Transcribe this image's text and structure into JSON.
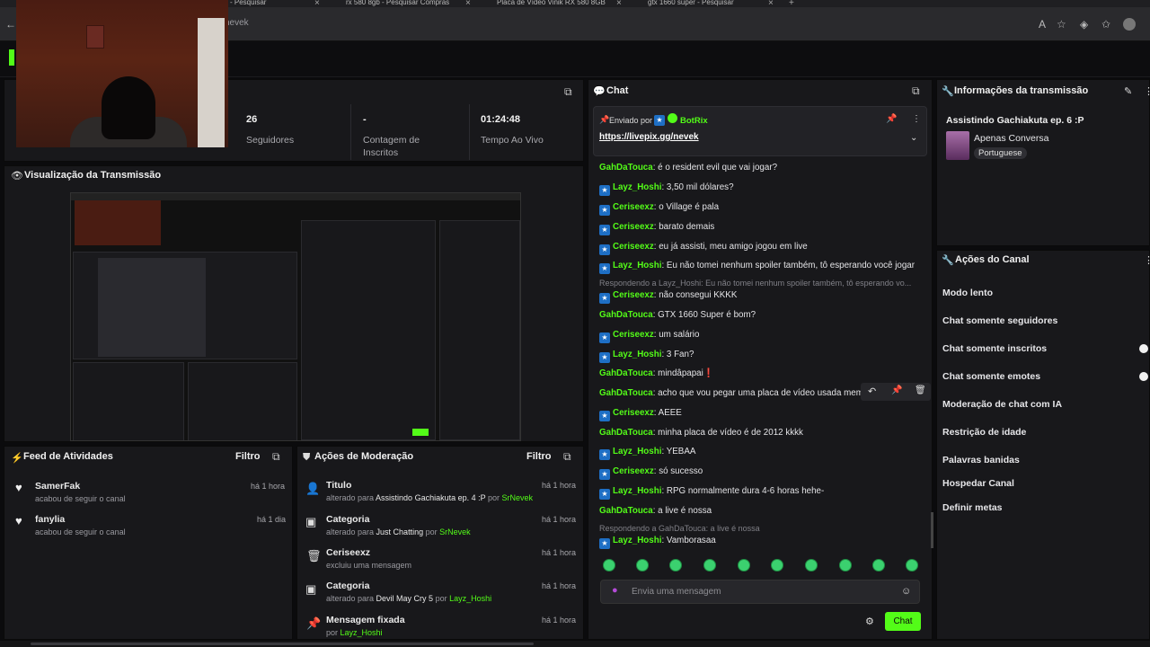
{
  "browser": {
    "tabs": [
      "- Pesquisar",
      "rx 580 8gb - Pesquisar Compras",
      "Placa de Vídeo Vinik RX 580 8GB",
      "gtx 1660 super - Pesquisar"
    ],
    "url": "nevek"
  },
  "stats": [
    {
      "value": "26",
      "label": "Seguidores"
    },
    {
      "value": "-",
      "label": "Contagem de Inscritos"
    },
    {
      "value": "01:24:48",
      "label": "Tempo Ao Vivo"
    }
  ],
  "preview": {
    "title": "Visualização da Transmissão"
  },
  "feed": {
    "title": "Feed de Atividades",
    "filter": "Filtro",
    "items": [
      {
        "name": "SamerFak",
        "sub": "acabou de seguir o canal",
        "time": "há 1 hora"
      },
      {
        "name": "fanylia",
        "sub": "acabou de seguir o canal",
        "time": "há 1 dia"
      }
    ]
  },
  "moderation": {
    "title": "Ações de Moderação",
    "filter": "Filtro",
    "items": [
      {
        "title": "Titulo",
        "pre": "alterado para ",
        "value": "Assistindo Gachiakuta ep. 4 :P",
        "by": " por ",
        "user": "SrNevek",
        "time": "há 1 hora"
      },
      {
        "title": "Categoria",
        "pre": "alterado para ",
        "value": "Just Chatting",
        "by": " por ",
        "user": "SrNevek",
        "time": "há 1 hora"
      },
      {
        "title": "Ceriseexz",
        "pre": "excluiu uma mensagem",
        "value": "",
        "by": "",
        "user": "",
        "time": "há 1 hora"
      },
      {
        "title": "Categoria",
        "pre": "alterado para ",
        "value": "Devil May Cry 5",
        "by": " por ",
        "user": "Layz_Hoshi",
        "time": "há 1 hora"
      },
      {
        "title": "Mensagem fixada",
        "pre": "por ",
        "value": "",
        "by": "",
        "user": "Layz_Hoshi",
        "time": "há 1 hora"
      }
    ]
  },
  "chat": {
    "title": "Chat",
    "pinned": {
      "label": "Enviado por",
      "user": "BotRix",
      "link": "https://livepix.gg/nevek"
    },
    "messages": [
      {
        "user": "GahDaTouca",
        "text": "é o resident evil que vai jogar?",
        "badge": false
      },
      {
        "user": "Layz_Hoshi",
        "text": "3,50 mil dólares?",
        "badge": true
      },
      {
        "user": "Ceriseexz",
        "text": "o Village é pala",
        "badge": true
      },
      {
        "user": "Ceriseexz",
        "text": "barato demais",
        "badge": true
      },
      {
        "user": "Ceriseexz",
        "text": "eu já assisti, meu amigo jogou em live",
        "badge": true
      },
      {
        "user": "Layz_Hoshi",
        "text": "Eu não tomei nenhum spoiler também, tô esperando você jogar",
        "badge": true
      },
      {
        "user": "Ceriseexz",
        "text": "não consegui KKKK",
        "badge": true
      },
      {
        "user": "GahDaTouca",
        "text": "GTX 1660 Super é bom?",
        "badge": false
      },
      {
        "user": "Ceriseexz",
        "text": "um salário",
        "badge": true
      },
      {
        "user": "Layz_Hoshi",
        "text": "3 Fan?",
        "badge": true
      },
      {
        "user": "GahDaTouca",
        "text": "mindâpapai❗",
        "badge": false
      },
      {
        "user": "GahDaTouca",
        "text": "acho que vou pegar uma placa de vídeo usada mem",
        "badge": false
      },
      {
        "user": "Ceriseexz",
        "text": "AEEE",
        "badge": true
      },
      {
        "user": "GahDaTouca",
        "text": "minha placa de vídeo é de 2012 kkkk",
        "badge": false
      },
      {
        "user": "Layz_Hoshi",
        "text": "YEBAA",
        "badge": true
      },
      {
        "user": "Ceriseexz",
        "text": "só sucesso",
        "badge": true
      },
      {
        "user": "Layz_Hoshi",
        "text": "RPG normalmente dura 4-6 horas hehe-",
        "badge": true
      },
      {
        "user": "GahDaTouca",
        "text": "a live é nossa",
        "badge": false
      },
      {
        "user": "Layz_Hoshi",
        "text": "Vamborasaa",
        "badge": true
      }
    ],
    "replies": [
      "Respondendo a Layz_Hoshi: Eu não tomei nenhum spoiler também, tô esperando vo...",
      "Respondendo a GahDaTouca: a live é nossa"
    ],
    "input_placeholder": "Envia uma mensagem",
    "send_label": "Chat"
  },
  "stream_info": {
    "title": "Informações da transmissão",
    "stream_title": "Assistindo Gachiakuta ep. 6 :P",
    "category": "Apenas Conversa",
    "language": "Portuguese"
  },
  "channel_actions": {
    "title": "Ações do Canal",
    "items": [
      "Modo lento",
      "Chat somente seguidores",
      "Chat somente inscritos",
      "Chat somente emotes",
      "Moderação de chat com IA",
      "Restrição de idade",
      "Palavras banidas",
      "Hospedar Canal",
      "Definir metas"
    ]
  },
  "colors": {
    "accent": "#53fc18",
    "panel": "#18181b",
    "background": "#0b0b0d"
  }
}
